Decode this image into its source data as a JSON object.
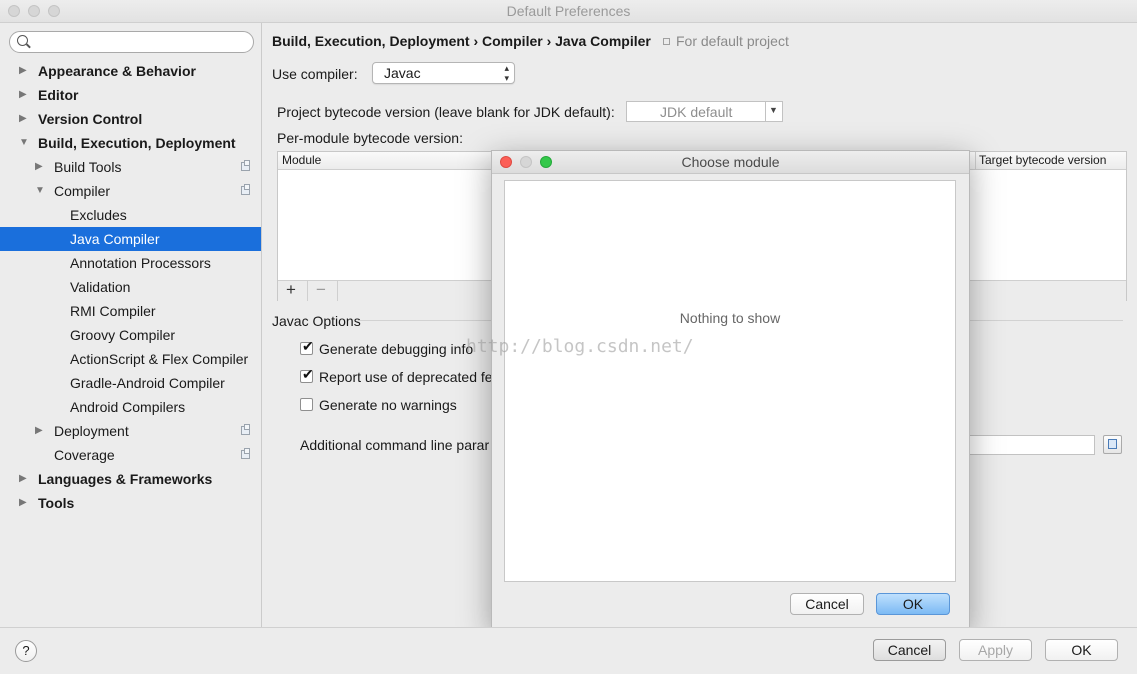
{
  "window": {
    "title": "Default Preferences"
  },
  "sidebar": {
    "search_placeholder": "",
    "items": [
      {
        "label": "Appearance & Behavior",
        "arrow": "▶"
      },
      {
        "label": "Editor",
        "arrow": "▶"
      },
      {
        "label": "Version Control",
        "arrow": "▶"
      },
      {
        "label": "Build, Execution, Deployment",
        "arrow": "▼"
      },
      {
        "label": "Build Tools",
        "arrow": "▶"
      },
      {
        "label": "Compiler",
        "arrow": "▼"
      },
      {
        "label": "Excludes"
      },
      {
        "label": "Java Compiler"
      },
      {
        "label": "Annotation Processors"
      },
      {
        "label": "Validation"
      },
      {
        "label": "RMI Compiler"
      },
      {
        "label": "Groovy Compiler"
      },
      {
        "label": "ActionScript & Flex Compiler"
      },
      {
        "label": "Gradle-Android Compiler"
      },
      {
        "label": "Android Compilers"
      },
      {
        "label": "Deployment",
        "arrow": "▶"
      },
      {
        "label": "Coverage"
      },
      {
        "label": "Languages & Frameworks",
        "arrow": "▶"
      },
      {
        "label": "Tools",
        "arrow": "▶"
      }
    ]
  },
  "main": {
    "breadcrumb": "Build, Execution, Deployment › Compiler › Java Compiler",
    "scope_note": "For default project",
    "use_compiler_label": "Use compiler:",
    "compiler_value": "Javac",
    "bytecode_label": "Project bytecode version (leave blank for JDK default):",
    "bytecode_value": "JDK default",
    "per_module_label": "Per-module bytecode version:",
    "table_headers": [
      "Module",
      "Target bytecode version"
    ],
    "add_symbol": "+",
    "remove_symbol": "−",
    "javac_options_label": "Javac Options",
    "checkboxes": [
      {
        "label": "Generate debugging info",
        "checked": true
      },
      {
        "label": "Report use of deprecated fe",
        "checked": true
      },
      {
        "label": "Generate no warnings",
        "checked": false
      }
    ],
    "additional_params_label": "Additional command line parar"
  },
  "dialog": {
    "title": "Choose module",
    "empty_text": "Nothing to show",
    "cancel": "Cancel",
    "ok": "OK"
  },
  "watermark": "http://blog.csdn.net/",
  "footer": {
    "help": "?",
    "cancel": "Cancel",
    "apply": "Apply",
    "ok": "OK"
  }
}
